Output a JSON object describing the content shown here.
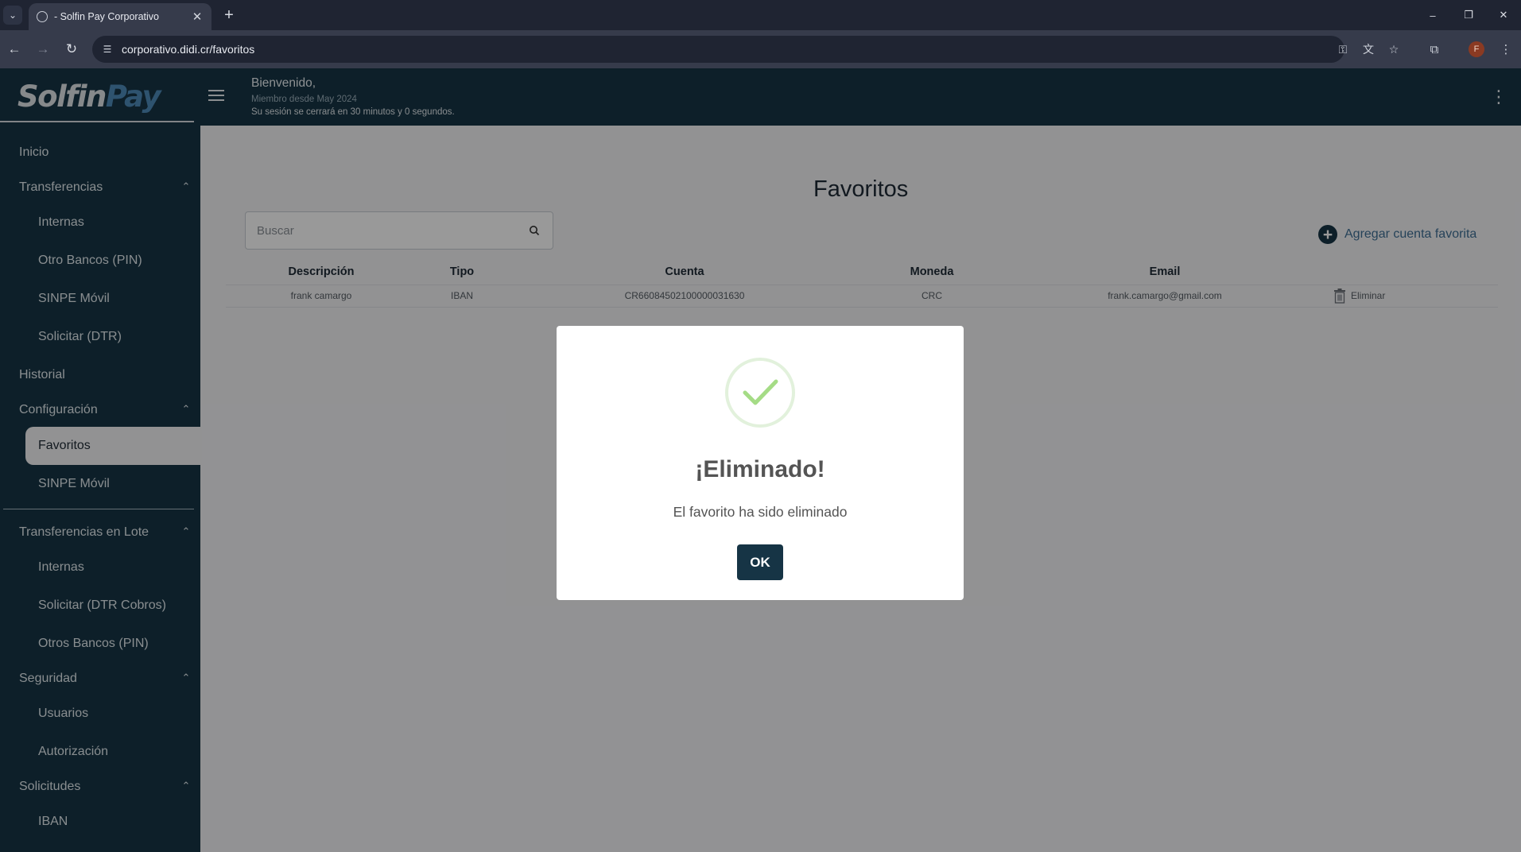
{
  "browser": {
    "tab_title": "- Solfin Pay Corporativo",
    "url": "corporativo.didi.cr/favoritos",
    "profile_initial": "F",
    "icons": {
      "tab_list": "chevron-down-icon",
      "tab_close": "close-icon",
      "new_tab": "plus-icon",
      "back": "back-arrow-icon",
      "forward": "forward-arrow-icon",
      "reload": "reload-icon",
      "site_info": "tune-icon",
      "password": "key-icon",
      "translate": "translate-icon",
      "bookmark": "star-icon",
      "extensions": "puzzle-icon",
      "menu": "kebab-icon"
    }
  },
  "header": {
    "logo_part1": "Solfin",
    "logo_part2": "Pay",
    "welcome": "Bienvenido,",
    "member_since": "Miembro desde May 2024",
    "session_notice": "Su sesión se cerrará en 30 minutos y 0 segundos."
  },
  "sidebar": {
    "items": [
      {
        "label": "Inicio"
      },
      {
        "label": "Transferencias"
      },
      {
        "label": "Internas"
      },
      {
        "label": "Otro Bancos (PIN)"
      },
      {
        "label": "SINPE Móvil"
      },
      {
        "label": "Solicitar (DTR)"
      },
      {
        "label": "Historial"
      },
      {
        "label": "Configuración"
      },
      {
        "label": "Favoritos"
      },
      {
        "label": "SINPE Móvil"
      },
      {
        "label": "Transferencias en Lote"
      },
      {
        "label": "Internas"
      },
      {
        "label": "Solicitar (DTR Cobros)"
      },
      {
        "label": "Otros Bancos (PIN)"
      },
      {
        "label": "Seguridad"
      },
      {
        "label": "Usuarios"
      },
      {
        "label": "Autorización"
      },
      {
        "label": "Solicitudes"
      },
      {
        "label": "IBAN"
      }
    ]
  },
  "main": {
    "title": "Favoritos",
    "search_placeholder": "Buscar",
    "add_favorite": "Agregar cuenta favorita",
    "table": {
      "headers": [
        "Descripción",
        "Tipo",
        "Cuenta",
        "Moneda",
        "Email"
      ],
      "rows": [
        {
          "descripcion": "frank camargo",
          "tipo": "IBAN",
          "cuenta": "CR66084502100000031630",
          "moneda": "CRC",
          "email": "frank.camargo@gmail.com",
          "action": "Eliminar"
        }
      ]
    }
  },
  "modal": {
    "title": "¡Eliminado!",
    "text": "El favorito ha sido eliminado",
    "ok_label": "OK",
    "icon": "success-check-icon",
    "colors": {
      "check": "#a5dc86",
      "ring": "#e2f1dc",
      "button": "#163445"
    }
  },
  "colors": {
    "brand_dark": "#163445",
    "brand_blue": "#4e8ab9",
    "link": "#3f6f95"
  }
}
